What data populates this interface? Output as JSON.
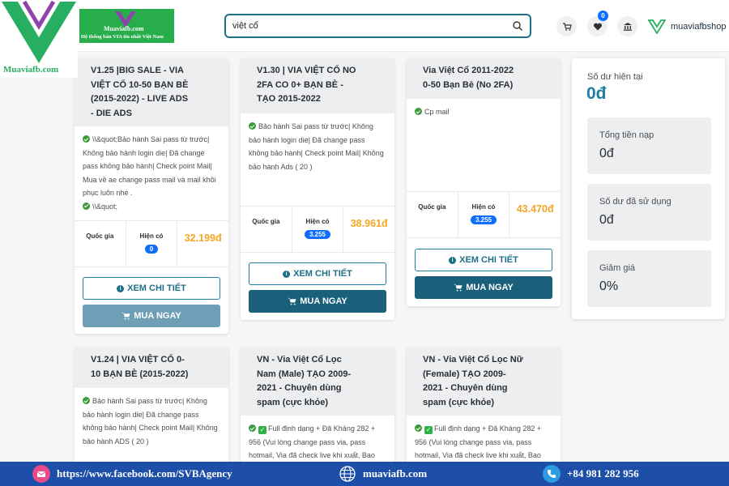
{
  "watermark": {
    "caption": "Muaviafb.com"
  },
  "header": {
    "banner_title": "Muaviafb.com",
    "banner_subtitle": "Hệ thống bán VIA tin nhất Việt Nam",
    "search_value": "việt cổ",
    "wishlist_count": "0",
    "shop_name": "muaviafbshop"
  },
  "labels": {
    "country": "Quốc gia",
    "available": "Hiện có",
    "detail_button": "XEM CHI TIẾT",
    "buy_button": "MUA NGAY"
  },
  "products": [
    {
      "title": "V1.25 |BIG SALE - VIA\nVIỆT CỔ 10-50 BẠN BÈ\n(2015-2022) - LIVE ADS\n- DIE ADS",
      "desc_lines": [
        "\\\\&quot;Bảo hành Sai pass từ trước| Không bảo hành login die| Đã change pass không bảo hành| Check point Mail| Mua về ae change pass mail và mail khôi phục luôn nhé ."
      ],
      "desc_extra": "\\\\&quot;",
      "stock": "0",
      "price": "32.199đ"
    },
    {
      "title": "V1.30 | VIA VIỆT CỔ NO\n2FA CO 0+ BẠN BÈ -\nTẠO 2015-2022",
      "desc_lines": [
        "Bảo hành Sai pass từ trước| Không bảo hành login die| Đã change pass không bảo hành| Check point Mail| Không bảo hành Ads ( 20 )"
      ],
      "stock": "3.255",
      "price": "38.961đ"
    },
    {
      "title": "Via Việt Cổ 2011-2022\n0-50 Bạn Bè (No 2FA)",
      "desc_lines": [
        "Cp mail"
      ],
      "stock": "3.255",
      "price": "43.470đ"
    },
    {
      "title": "V1.24 | VIA VIỆT CỔ 0-\n10 BẠN BÈ (2015-2022)",
      "desc_lines": [
        "Bảo hành Sai pass từ trước| Không bảo hành login die| Đã change pass không bảo hành| Check point Mail| Không bảo hành ADS ( 20 )"
      ]
    },
    {
      "title": "VN - Via Việt Cổ Lọc\nNam (Male) TẠO 2009-\n2021 - Chuyên dùng\nspam (cực khỏe)",
      "desc_lines": [
        "Full định dạng + Đã Kháng 282 + 956 (Vui lòng change pass via, pass hotmail, Via đã check live khi xuất, Bao"
      ]
    },
    {
      "title": "VN - Via Việt Cổ Lọc Nữ\n(Female) TẠO 2009-\n2021 - Chuyên dùng\nspam (cực khỏe)",
      "desc_lines": [
        "Full định dạng + Đã Kháng 282 + 956 (Vui lòng change pass via, pass hotmail, Via đã check live khi xuất, Bao"
      ]
    }
  ],
  "balance": {
    "current_label": "Số dư hiện tại",
    "current_value": "0đ",
    "deposit_label": "Tổng tiền nạp",
    "deposit_value": "0đ",
    "used_label": "Số dư đã sử dụng",
    "used_value": "0đ",
    "discount_label": "Giảm giá",
    "discount_value": "0%"
  },
  "footer": {
    "facebook": "https://www.facebook.com/SVBAgency",
    "website": "muaviafb.com",
    "phone": "+84 981 282 956"
  }
}
